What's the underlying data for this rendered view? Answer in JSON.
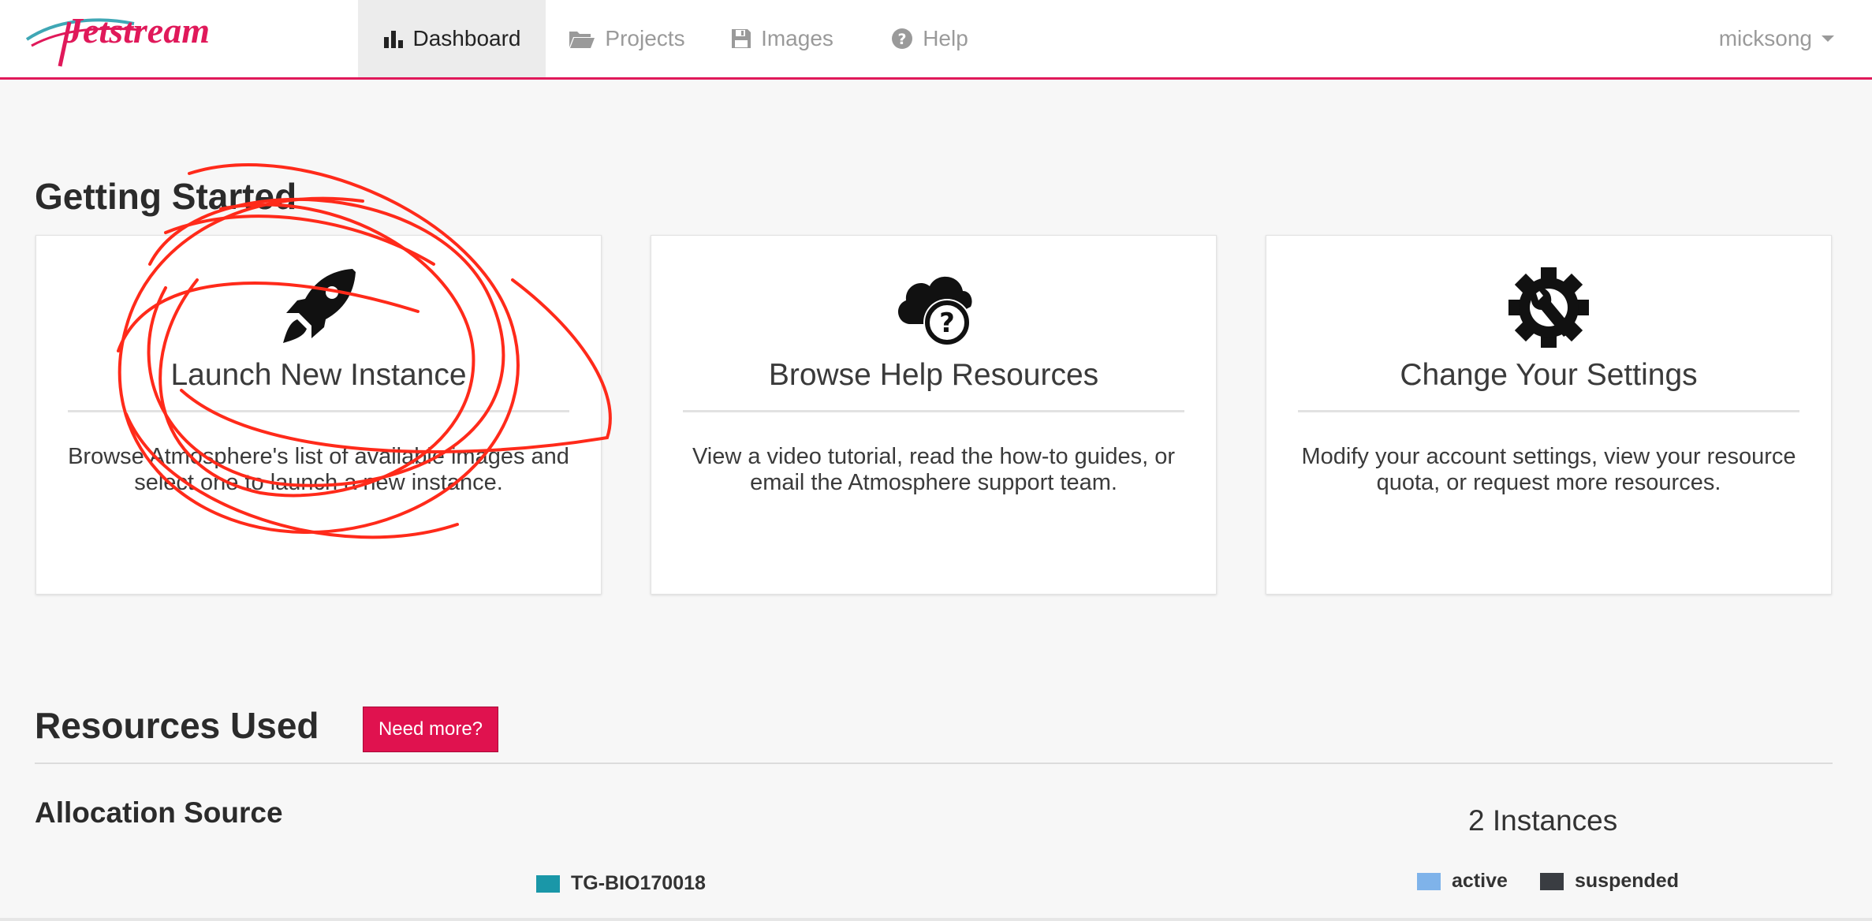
{
  "navbar": {
    "logo_text": "Jetstream",
    "tabs": [
      {
        "label": "Dashboard",
        "icon": "bar-chart-icon",
        "active": true
      },
      {
        "label": "Projects",
        "icon": "folder-open-icon",
        "active": false
      },
      {
        "label": "Images",
        "icon": "floppy-disk-icon",
        "active": false
      },
      {
        "label": "Help",
        "icon": "question-circle-icon",
        "active": false
      }
    ],
    "user": "micksong"
  },
  "getting_started": {
    "title": "Getting Started",
    "cards": [
      {
        "icon": "rocket-icon",
        "title": "Launch New Instance",
        "description": "Browse Atmosphere's list of available images and select one to launch a new instance."
      },
      {
        "icon": "cloud-question-icon",
        "title": "Browse Help Resources",
        "description": "View a video tutorial, read the how-to guides, or email the Atmosphere support team."
      },
      {
        "icon": "gear-wrench-icon",
        "title": "Change Your Settings",
        "description": "Modify your account settings, view your resource quota, or request more resources."
      }
    ]
  },
  "resources": {
    "title": "Resources Used",
    "need_more_label": "Need more?",
    "allocation_title": "Allocation Source",
    "allocation_legend": "TG-BIO170018",
    "instances_title": "2 Instances",
    "legend_active": "active",
    "legend_suspended": "suspended"
  },
  "colors": {
    "accent": "#e0195a",
    "allocation_swatch": "#1a97a8",
    "active_swatch": "#7fb3ea",
    "suspended_swatch": "#3a3d42",
    "annotation": "#ff2a1a"
  }
}
